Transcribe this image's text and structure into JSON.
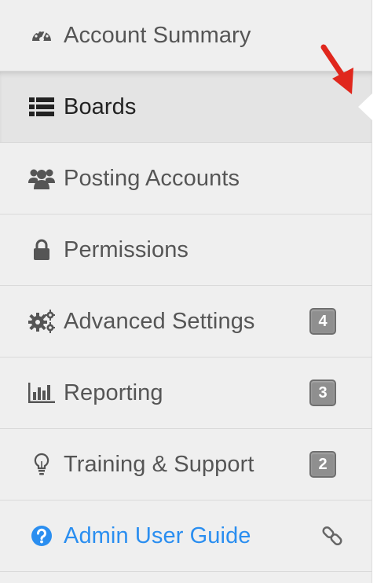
{
  "sidebar": {
    "items": [
      {
        "label": "Account Summary",
        "icon": "dashboard-icon"
      },
      {
        "label": "Boards",
        "icon": "list-icon",
        "active": true
      },
      {
        "label": "Posting Accounts",
        "icon": "users-icon"
      },
      {
        "label": "Permissions",
        "icon": "lock-icon"
      },
      {
        "label": "Advanced Settings",
        "icon": "gears-icon",
        "badge": "4"
      },
      {
        "label": "Reporting",
        "icon": "bar-chart-icon",
        "badge": "3"
      },
      {
        "label": "Training & Support",
        "icon": "lightbulb-icon",
        "badge": "2"
      },
      {
        "label": "Admin User Guide",
        "icon": "question-circle-icon",
        "link_icon": "link-icon"
      }
    ]
  },
  "colors": {
    "sidebar_bg": "#efefef",
    "active_bg": "#e4e4e4",
    "text": "#555555",
    "active_text": "#222222",
    "link": "#2a8ef0",
    "badge": "#8f8f8f",
    "annotation_arrow": "#e0271d"
  }
}
